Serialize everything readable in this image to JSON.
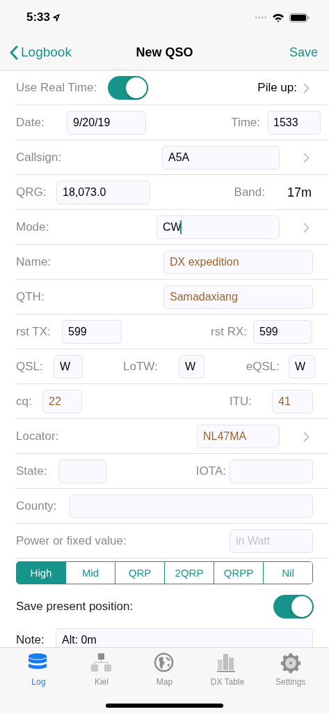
{
  "status_bar": {
    "time": "5:33"
  },
  "nav": {
    "back": "Logbook",
    "title": "New QSO",
    "action": "Save"
  },
  "rows": [
    {
      "kind": "fields",
      "items": [
        {
          "kind": "label",
          "text": "Use Real Time:"
        },
        {
          "kind": "switch",
          "on": true
        },
        {
          "kind": "link",
          "text": "Pile up:"
        },
        {
          "kind": "chevron"
        }
      ]
    },
    {
      "kind": "fields",
      "items": [
        {
          "kind": "label",
          "text": "Date:"
        },
        {
          "kind": "field",
          "value": "9/20/19",
          "autofilled": false
        },
        {
          "kind": "label",
          "text": "Time:"
        },
        {
          "kind": "field",
          "value": "1533",
          "autofilled": false
        }
      ]
    },
    {
      "kind": "fields",
      "items": [
        {
          "kind": "label",
          "text": "Callsign:"
        },
        {
          "kind": "field",
          "value": "A5A",
          "autofilled": false
        },
        {
          "kind": "chevron"
        }
      ]
    },
    {
      "kind": "fields",
      "items": [
        {
          "kind": "label",
          "text": "QRG:"
        },
        {
          "kind": "field",
          "value": "18,073.0",
          "autofilled": false
        },
        {
          "kind": "label",
          "text": "Band:"
        },
        {
          "kind": "value",
          "text": "17m"
        }
      ]
    },
    {
      "kind": "fields",
      "items": [
        {
          "kind": "label",
          "text": "Mode:"
        },
        {
          "kind": "field",
          "value": "CW",
          "autofilled": false,
          "focused": true
        },
        {
          "kind": "chevron"
        }
      ]
    },
    {
      "kind": "fields",
      "items": [
        {
          "kind": "label",
          "text": "Name:"
        },
        {
          "kind": "field",
          "value": "DX expedition",
          "autofilled": true
        }
      ]
    },
    {
      "kind": "fields",
      "items": [
        {
          "kind": "label",
          "text": "QTH:"
        },
        {
          "kind": "field",
          "value": "Samadaxiang",
          "autofilled": true
        }
      ]
    },
    {
      "kind": "fields",
      "items": [
        {
          "kind": "label",
          "text": "rst TX:"
        },
        {
          "kind": "field",
          "value": "599",
          "autofilled": false
        },
        {
          "kind": "label",
          "text": "rst RX:"
        },
        {
          "kind": "field",
          "value": "599",
          "autofilled": false
        }
      ]
    },
    {
      "kind": "fields",
      "items": [
        {
          "kind": "label",
          "text": "QSL:"
        },
        {
          "kind": "field",
          "value": "W",
          "autofilled": false
        },
        {
          "kind": "label",
          "text": "LoTW:"
        },
        {
          "kind": "field",
          "value": "W",
          "autofilled": false
        },
        {
          "kind": "label",
          "text": "eQSL:"
        },
        {
          "kind": "field",
          "value": "W",
          "autofilled": false
        }
      ]
    },
    {
      "kind": "fields",
      "items": [
        {
          "kind": "label",
          "text": "cq:"
        },
        {
          "kind": "field",
          "value": "22",
          "autofilled": true
        },
        {
          "kind": "label",
          "text": "ITU:"
        },
        {
          "kind": "field",
          "value": "41",
          "autofilled": true
        }
      ]
    },
    {
      "kind": "fields",
      "items": [
        {
          "kind": "label",
          "text": "Locator:"
        },
        {
          "kind": "field",
          "value": "NL47MA",
          "autofilled": true
        },
        {
          "kind": "chevron"
        }
      ]
    },
    {
      "kind": "fields",
      "items": [
        {
          "kind": "label",
          "text": "State:"
        },
        {
          "kind": "field"
        },
        {
          "kind": "label",
          "text": "IOTA:"
        },
        {
          "kind": "field"
        }
      ]
    },
    {
      "kind": "fields",
      "items": [
        {
          "kind": "label",
          "text": "County:"
        },
        {
          "kind": "field"
        }
      ]
    },
    {
      "kind": "fields",
      "items": [
        {
          "kind": "label",
          "text": "Power or fixed value:"
        },
        {
          "kind": "field",
          "placeholder": "in Watt"
        }
      ]
    },
    {
      "kind": "segmented",
      "segments": [
        {
          "label": "High",
          "selected": true
        },
        {
          "label": "Mid",
          "selected": false
        },
        {
          "label": "QRP",
          "selected": false
        },
        {
          "label": "2QRP",
          "selected": false
        },
        {
          "label": "QRPP",
          "selected": false
        },
        {
          "label": "Nil",
          "selected": false
        }
      ]
    },
    {
      "kind": "fields",
      "items": [
        {
          "kind": "dark-label",
          "text": "Save present position:"
        },
        {
          "kind": "switch",
          "on": true
        }
      ]
    },
    {
      "kind": "fields",
      "items": [
        {
          "kind": "dark-label",
          "text": "Note:"
        },
        {
          "kind": "field",
          "value": "Alt: 0m",
          "autofilled": false
        }
      ]
    }
  ],
  "tabs": [
    {
      "label": "Log",
      "selected": true
    },
    {
      "label": "Kiel",
      "selected": false
    },
    {
      "label": "Map",
      "selected": false
    },
    {
      "label": "DX Table",
      "selected": false
    },
    {
      "label": "Settings",
      "selected": false
    }
  ]
}
